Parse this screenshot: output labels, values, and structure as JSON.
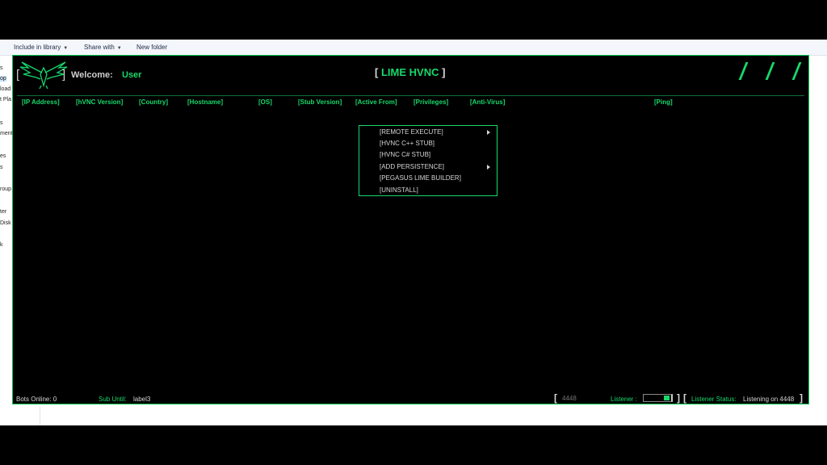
{
  "explorer": {
    "toolbar": {
      "include_library": "Include in library",
      "share_with": "Share with",
      "new_folder": "New folder"
    },
    "nav_fragments": [
      "s",
      "op",
      "load",
      "t Pla",
      "s",
      "ment",
      "es",
      "s",
      "roup",
      "ter",
      "Disk",
      "k"
    ]
  },
  "app": {
    "welcome_label": "Welcome:",
    "username": "User",
    "title": "LIME HVNC",
    "bracket_open": "[",
    "bracket_close": "]",
    "columns": [
      "[IP Address]",
      "[hVNC Version]",
      "[Country]",
      "[Hostname]",
      "[OS]",
      "[Stub Version]",
      "[Active From]",
      "[Privileges]",
      "[Anti-Virus]",
      "[Ping]"
    ],
    "context_menu": {
      "items": [
        {
          "label": "[REMOTE EXECUTE]",
          "submenu": true
        },
        {
          "label": "[HVNC C++ STUB]",
          "submenu": false
        },
        {
          "label": "[HVNC C# STUB]",
          "submenu": false
        },
        {
          "label": "[ADD PERSISTENCE]",
          "submenu": true
        },
        {
          "label": "[PEGASUS LIME BUILDER]",
          "submenu": false
        },
        {
          "label": "[UNINSTALL]",
          "submenu": false
        }
      ]
    },
    "footer": {
      "bots_online": "Bots Online: 0",
      "sub_until_label": "Sub Until:",
      "sub_until_value": "label3",
      "port_placeholder": "4448",
      "listener_label": "Listener :",
      "listener_on": true,
      "listener_status_label": "Listener Status:",
      "listener_status_value": "Listening on 4448"
    },
    "colors": {
      "accent": "#17d86b",
      "background": "#000000",
      "text": "#d6d6d6"
    }
  }
}
